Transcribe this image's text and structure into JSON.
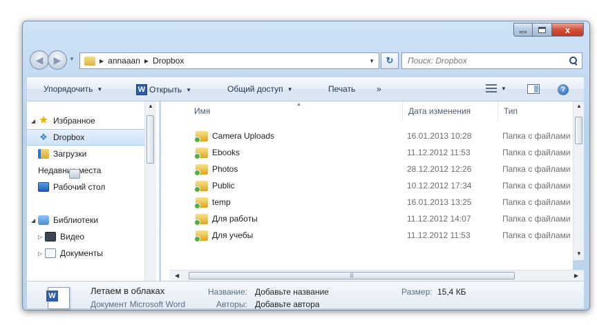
{
  "window": {
    "caption_minimize": "–",
    "caption_close": "x"
  },
  "address": {
    "path": [
      "annaaan",
      "Dropbox"
    ],
    "search_placeholder": "Поиск: Dropbox"
  },
  "toolbar": {
    "organize": "Упорядочить",
    "open": "Открыть",
    "share": "Общий доступ",
    "print": "Печать",
    "more": "»",
    "word_letter": "W",
    "help": "?"
  },
  "nav": {
    "favorites": "Избранное",
    "dropbox": "Dropbox",
    "downloads": "Загрузки",
    "recent": "Недавние места",
    "desktop": "Рабочий стол",
    "libraries": "Библиотеки",
    "video": "Видео",
    "documents": "Документы"
  },
  "columns": {
    "name": "Имя",
    "date": "Дата изменения",
    "type": "Тип"
  },
  "files": [
    {
      "name": "Camera Uploads",
      "date": "16.01.2013 10:28",
      "type": "Папка с файлами",
      "icon": "folder-sync"
    },
    {
      "name": "Ebooks",
      "date": "11.12.2012 11:53",
      "type": "Папка с файлами",
      "icon": "folder-sync"
    },
    {
      "name": "Photos",
      "date": "28.12.2012 12:26",
      "type": "Папка с файлами",
      "icon": "folder-sync"
    },
    {
      "name": "Public",
      "date": "10.12.2012 17:34",
      "type": "Папка с файлами",
      "icon": "folder-sync"
    },
    {
      "name": "temp",
      "date": "16.01.2013 13:25",
      "type": "Папка с файлами",
      "icon": "folder-sync"
    },
    {
      "name": "Для работы",
      "date": "11.12.2012 14:07",
      "type": "Папка с файлами",
      "icon": "folder-sync"
    },
    {
      "name": "Для учебы",
      "date": "11.12.2012 11:53",
      "type": "Папка с файлами",
      "icon": "folder-sync"
    }
  ],
  "details": {
    "file_name": "Летаем в облаках",
    "file_kind": "Документ Microsoft Word",
    "title_label": "Название:",
    "title_value": "Добавьте название",
    "authors_label": "Авторы:",
    "authors_value": "Добавьте автора",
    "size_label": "Размер:",
    "size_value": "15,4 КБ",
    "word_letter": "W"
  },
  "colors": {
    "frame": "#b9d3ee",
    "selection": "#cfe3f8",
    "close_button": "#c2361c"
  }
}
